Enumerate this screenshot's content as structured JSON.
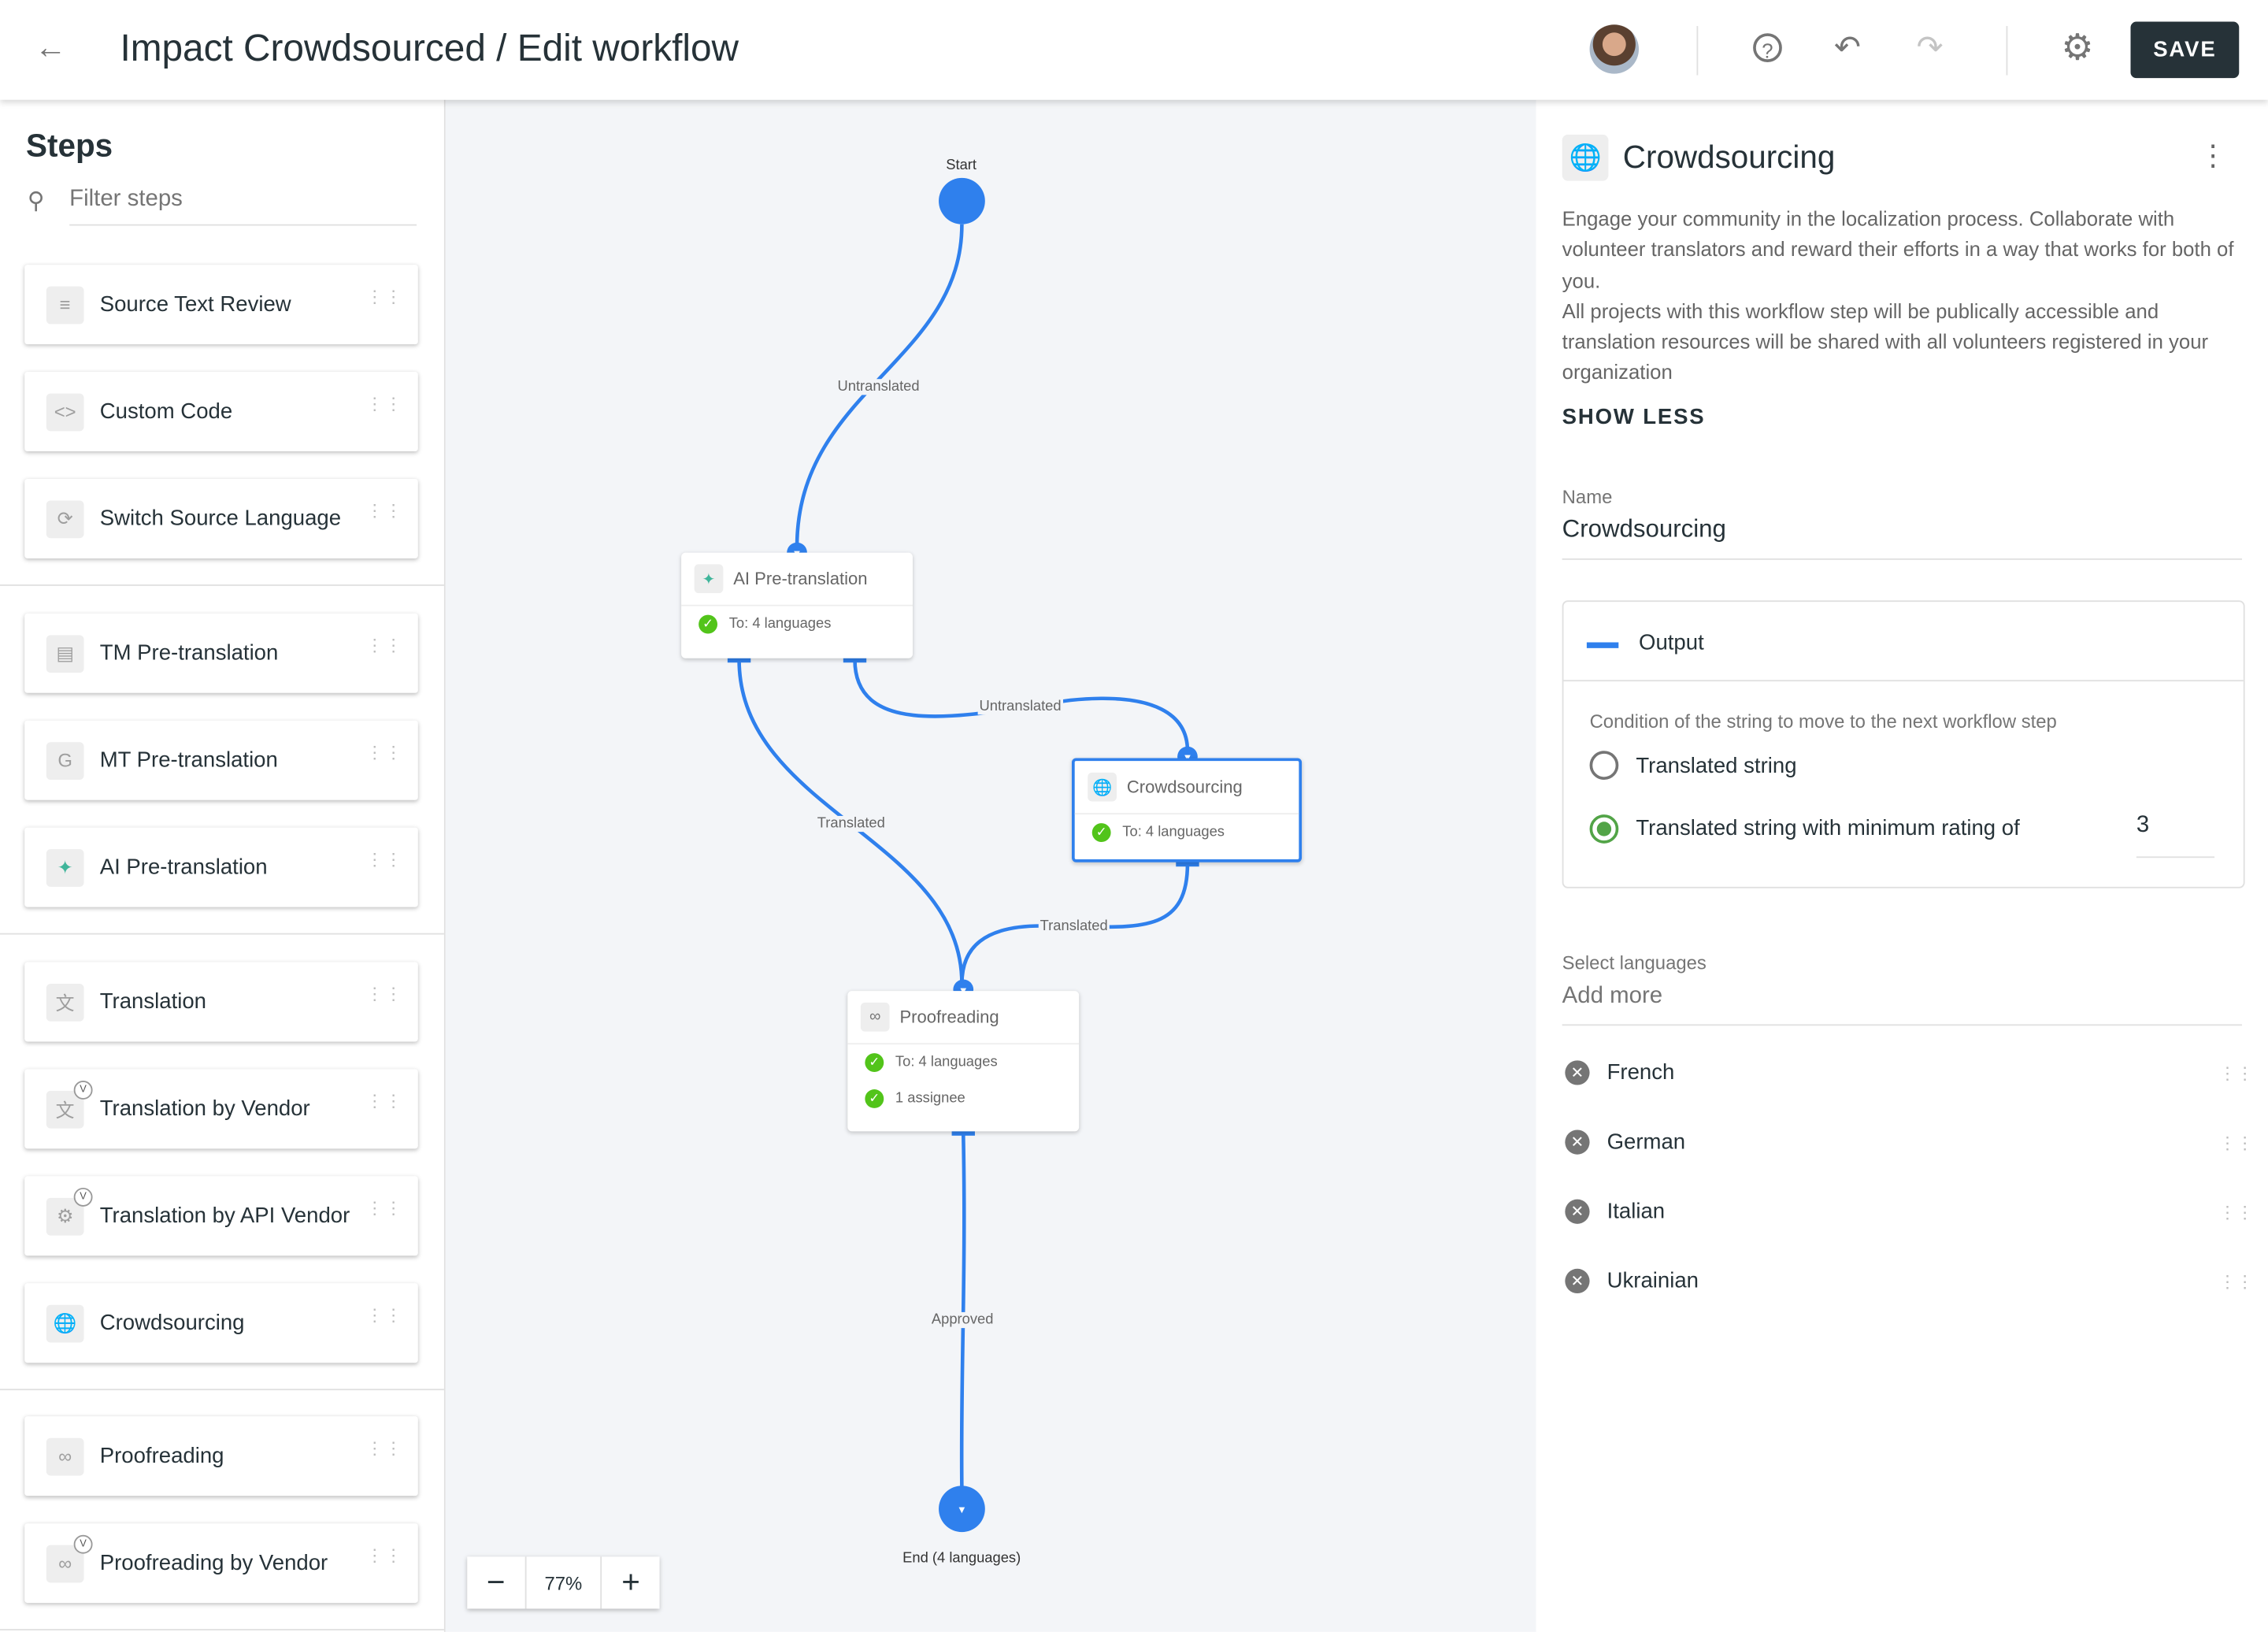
{
  "header": {
    "title": "Impact Crowdsourced / Edit workflow",
    "save_label": "SAVE"
  },
  "sidebar": {
    "title": "Steps",
    "filter_placeholder": "Filter steps",
    "items": [
      {
        "label": "Source Text Review",
        "icon": "review-icon"
      },
      {
        "label": "Custom Code",
        "icon": "code-icon"
      },
      {
        "label": "Switch Source Language",
        "icon": "switch-icon"
      },
      {
        "label": "TM Pre-translation",
        "icon": "tm-icon"
      },
      {
        "label": "MT Pre-translation",
        "icon": "mt-icon"
      },
      {
        "label": "AI Pre-translation",
        "icon": "ai-icon"
      },
      {
        "label": "Translation",
        "icon": "translate-icon"
      },
      {
        "label": "Translation by Vendor",
        "icon": "translate-icon",
        "badge": "V"
      },
      {
        "label": "Translation by API Vendor",
        "icon": "gear-icon",
        "badge": "V"
      },
      {
        "label": "Crowdsourcing",
        "icon": "globe-icon"
      },
      {
        "label": "Proofreading",
        "icon": "glasses-icon"
      },
      {
        "label": "Proofreading by Vendor",
        "icon": "glasses-icon",
        "badge": "V"
      }
    ]
  },
  "canvas": {
    "start": "Start",
    "end": "End (4 languages)",
    "nodes": {
      "ai": {
        "title": "AI Pre-translation",
        "rows": [
          "To: 4 languages"
        ]
      },
      "crowd": {
        "title": "Crowdsourcing",
        "rows": [
          "To: 4 languages"
        ]
      },
      "proof": {
        "title": "Proofreading",
        "rows": [
          "To: 4 languages",
          "1 assignee"
        ]
      }
    },
    "edges": {
      "e1": "Untranslated",
      "e2": "Translated",
      "e3": "Untranslated",
      "e4": "Translated",
      "e5": "Approved"
    },
    "zoom": "77%",
    "accent": "#2f80ed"
  },
  "panel": {
    "title": "Crowdsourcing",
    "desc1": "Engage your community in the localization process. Collaborate with volunteer translators and reward their efforts in a way that works for both of you.",
    "desc2": "All projects with this workflow step will be publically accessible and translation resources will be shared with all volunteers registered in your organization",
    "show_less": "SHOW LESS",
    "name_label": "Name",
    "name_value": "Crowdsourcing",
    "output_label": "Output",
    "condition_label": "Condition of the string to move to the next workflow step",
    "option1": "Translated string",
    "option2": "Translated string with minimum rating of",
    "rating": "3",
    "selected_option": 2,
    "languages_label": "Select languages",
    "add_more_placeholder": "Add more",
    "languages": [
      "French",
      "German",
      "Italian",
      "Ukrainian"
    ]
  }
}
